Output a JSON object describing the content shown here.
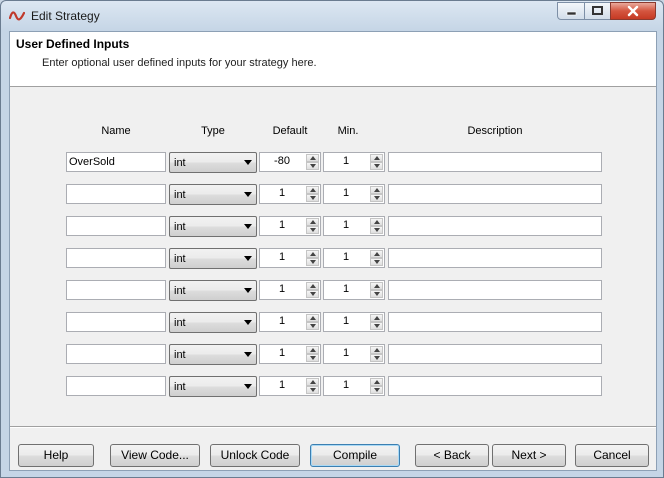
{
  "window": {
    "title": "Edit Strategy"
  },
  "header": {
    "title": "User Defined Inputs",
    "subtitle": "Enter optional user defined inputs for your strategy here."
  },
  "columns": {
    "name": "Name",
    "type": "Type",
    "default": "Default",
    "min": "Min.",
    "description": "Description"
  },
  "rows": [
    {
      "name": "OverSold",
      "type": "int",
      "default": "-80",
      "min": "1",
      "description": ""
    },
    {
      "name": "",
      "type": "int",
      "default": "1",
      "min": "1",
      "description": ""
    },
    {
      "name": "",
      "type": "int",
      "default": "1",
      "min": "1",
      "description": ""
    },
    {
      "name": "",
      "type": "int",
      "default": "1",
      "min": "1",
      "description": ""
    },
    {
      "name": "",
      "type": "int",
      "default": "1",
      "min": "1",
      "description": ""
    },
    {
      "name": "",
      "type": "int",
      "default": "1",
      "min": "1",
      "description": ""
    },
    {
      "name": "",
      "type": "int",
      "default": "1",
      "min": "1",
      "description": ""
    },
    {
      "name": "",
      "type": "int",
      "default": "1",
      "min": "1",
      "description": ""
    }
  ],
  "buttons": {
    "help": "Help",
    "view_code": "View Code...",
    "unlock_code": "Unlock Code",
    "compile": "Compile",
    "back": "< Back",
    "next": "Next >",
    "cancel": "Cancel"
  },
  "icons": {
    "app": "waveform-icon",
    "minimize": "minimize-icon",
    "maximize": "maximize-icon",
    "close": "close-icon"
  },
  "colors": {
    "app_icon": "#c0392b",
    "close_button": "#c53a24"
  }
}
